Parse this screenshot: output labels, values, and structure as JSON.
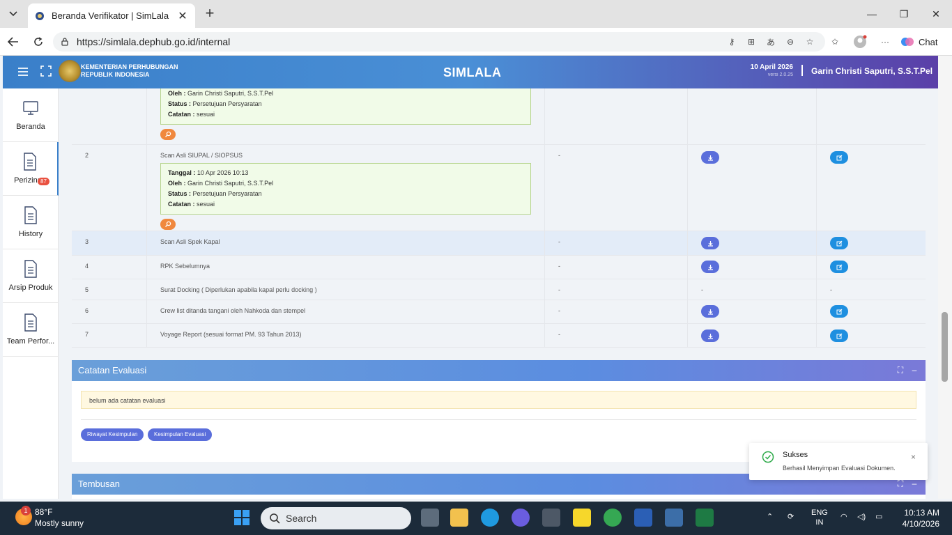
{
  "browser": {
    "tab_title": "Beranda Verifikator | SimLala",
    "url": "https://simlala.dephub.go.id/internal",
    "chat_label": "Chat"
  },
  "header": {
    "org_line1": "KEMENTERIAN PERHUBUNGAN",
    "org_line2": "REPUBLIK INDONESIA",
    "brand": "SIMLALA",
    "date": "10 April 2026",
    "version": "versi 2.0.25",
    "user": "Garin Christi Saputri, S.S.T.Pel"
  },
  "sidebar": {
    "items": [
      {
        "label": "Beranda"
      },
      {
        "label": "Perizinan",
        "badge": "87"
      },
      {
        "label": "History"
      },
      {
        "label": "Arsip Produk"
      },
      {
        "label": "Team Perfor..."
      }
    ]
  },
  "documents": {
    "row0": {
      "oleh_label": "Oleh :",
      "oleh": "Garin Christi Saputri, S.S.T.Pel",
      "status_label": "Status :",
      "status": "Persetujuan Persyaratan",
      "catatan_label": "Catatan :",
      "catatan": "sesuai"
    },
    "row2": {
      "no": "2",
      "name": "Scan Asli SIUPAL / SIOPSUS",
      "tanggal_label": "Tanggal :",
      "tanggal": "10 Apr 2026 10:13",
      "oleh_label": "Oleh :",
      "oleh": "Garin Christi Saputri, S.S.T.Pel",
      "status_label": "Status :",
      "status": "Persetujuan Persyaratan",
      "catatan_label": "Catatan :",
      "catatan": "sesuai",
      "col3": "-"
    },
    "rows": [
      {
        "no": "3",
        "name": "Scan Asli Spek Kapal",
        "col3": "-"
      },
      {
        "no": "4",
        "name": "RPK Sebelumnya",
        "col3": "-"
      },
      {
        "no": "5",
        "name": "Surat Docking ( Diperlukan apabila kapal perlu docking )",
        "col3": "-",
        "col4": "-",
        "col5": "-"
      },
      {
        "no": "6",
        "name": "Crew list ditanda tangani oleh Nahkoda dan stempel",
        "col3": "-"
      },
      {
        "no": "7",
        "name": "Voyage Report (sesuai format PM. 93 Tahun 2013)",
        "col3": "-"
      }
    ]
  },
  "evaluasi": {
    "title": "Catatan Evaluasi",
    "note": "belum ada catatan evaluasi",
    "btn_riwayat": "Riwayat Kesimpulan",
    "btn_kesimpulan": "Kesimpulan Evaluasi"
  },
  "tembusan": {
    "title": "Tembusan"
  },
  "toast": {
    "title": "Sukses",
    "message": "Berhasil Menyimpan Evaluasi Dokumen.",
    "close": "×"
  },
  "taskbar": {
    "weather_badge": "1",
    "temp": "88°F",
    "condition": "Mostly sunny",
    "search": "Search",
    "lang1": "ENG",
    "lang2": "IN",
    "time": "10:13 AM",
    "date": "4/10/2026"
  },
  "colors": {
    "accent": "#3a7fc9",
    "download": "#5a6edb",
    "edit": "#1e8fe0",
    "success": "#2eaa4a"
  }
}
